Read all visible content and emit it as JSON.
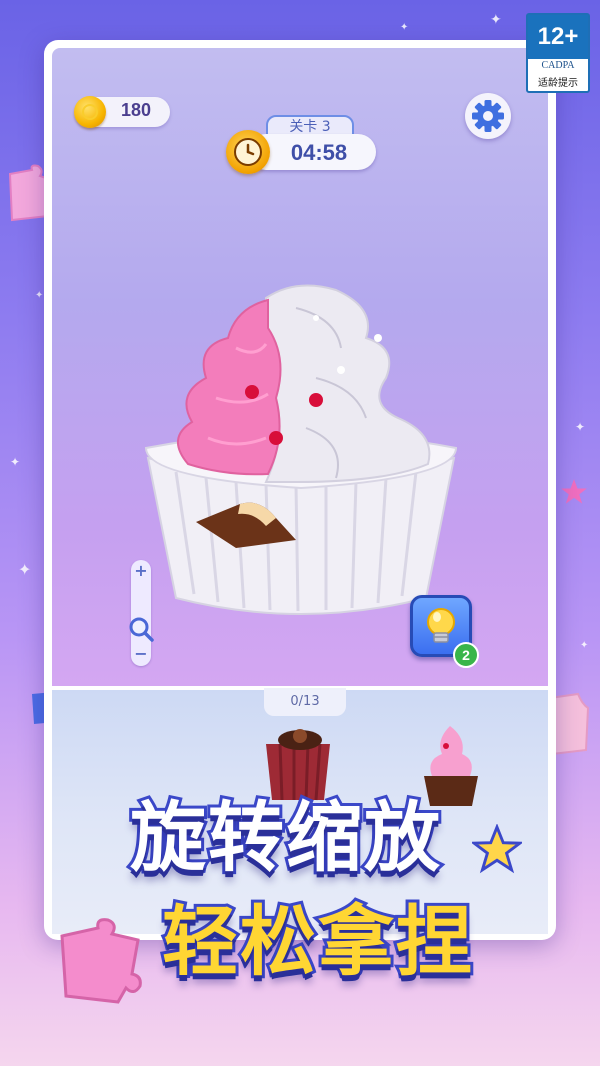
{
  "hud": {
    "coins": "180",
    "level_label": "关卡 3",
    "timer": "04:58"
  },
  "progress": {
    "label": "0/13",
    "placed": 0,
    "total": 13
  },
  "hint": {
    "count": "2"
  },
  "zoom": {
    "plus": "+",
    "minus": "−"
  },
  "promo": {
    "line1": "旋转缩放",
    "line2": "轻松拿捏"
  },
  "age_rating": {
    "rating": "12+",
    "org": "CADPA",
    "tip": "适龄提示"
  },
  "colors": {
    "accent": "#3b48c9",
    "coin": "#f7b500",
    "frosting_pink": "#f27ab8",
    "hint_blue": "#3b6ff0",
    "badge_green": "#39b54a"
  },
  "icons": [
    "coin-icon",
    "gear-icon",
    "clock-icon",
    "magnifier-icon",
    "lightbulb-icon",
    "sparkle-icon",
    "star-icon",
    "puzzle-piece-icon"
  ]
}
